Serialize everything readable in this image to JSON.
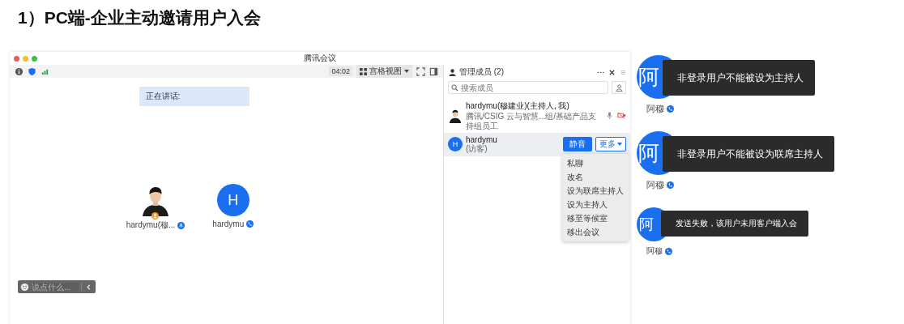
{
  "heading": "1）PC端-企业主动邀请用户入会",
  "meeting_window": {
    "title": "腾讯会议",
    "timer": "04:02",
    "view_mode": "宫格视图",
    "speaking_label": "正在讲话:",
    "tiles": [
      {
        "name": "hardymu(穆...",
        "phone_audio": false
      },
      {
        "kind": "initial",
        "initial": "H",
        "name": "hardymu",
        "phone_audio": true
      }
    ],
    "chat": {
      "placeholder": "说点什么..."
    },
    "members_panel": {
      "title": "管理成员 (2)",
      "search": {
        "placeholder": "搜索成员"
      },
      "members": [
        {
          "name": "hardymu(穆建业)(主持人, 我)",
          "subtitle": "腾讯/CSIG 云与智慧...组/基础产品支持组员工",
          "selected": false
        },
        {
          "kind": "initial",
          "initial": "H",
          "name": "hardymu",
          "subtitle": "(访客)",
          "selected": true,
          "actions": [
            "静音",
            "更多"
          ]
        }
      ],
      "context_menu": [
        "私聊",
        "改名",
        "设为联席主持人",
        "设为主持人",
        "移至等候室",
        "移出会议"
      ]
    }
  },
  "toasts": [
    {
      "avatar": "阿",
      "message": "非登录用户不能被设为主持人",
      "name": "阿穆"
    },
    {
      "avatar": "阿",
      "message": "非登录用户不能被设为联席主持人",
      "name": "阿穆"
    },
    {
      "avatar": "阿",
      "message": "发送失败，该用户未用客户端入会",
      "name": "阿穆"
    }
  ]
}
